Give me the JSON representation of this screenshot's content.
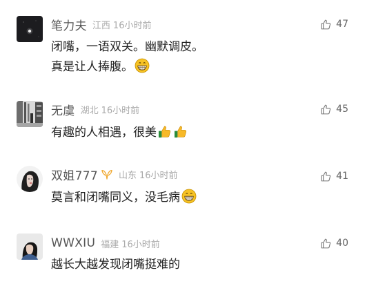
{
  "comments": [
    {
      "username": "笔力夫",
      "location": "江西",
      "time": "16小时前",
      "likes": "47",
      "lines": [
        "闭嘴，一语双关。幽默调皮。",
        "真是让人捧腹。"
      ],
      "emoji": [
        "grinning-face"
      ]
    },
    {
      "username": "无虞",
      "location": "湖北",
      "time": "16小时前",
      "likes": "45",
      "lines": [
        "有趣的人相遇，很美"
      ],
      "emoji": [
        "thumbs-up",
        "thumbs-up"
      ]
    },
    {
      "username": "双姐777",
      "location": "山东",
      "time": "16小时前",
      "likes": "41",
      "lines": [
        "莫言和闭嘴同义，没毛病"
      ],
      "emoji": [
        "grinning-face"
      ]
    },
    {
      "username": "WWXIU",
      "location": "福建",
      "time": "16小时前",
      "likes": "40",
      "lines": [
        "越长大越发现闭嘴挺难的"
      ],
      "emoji": []
    }
  ]
}
